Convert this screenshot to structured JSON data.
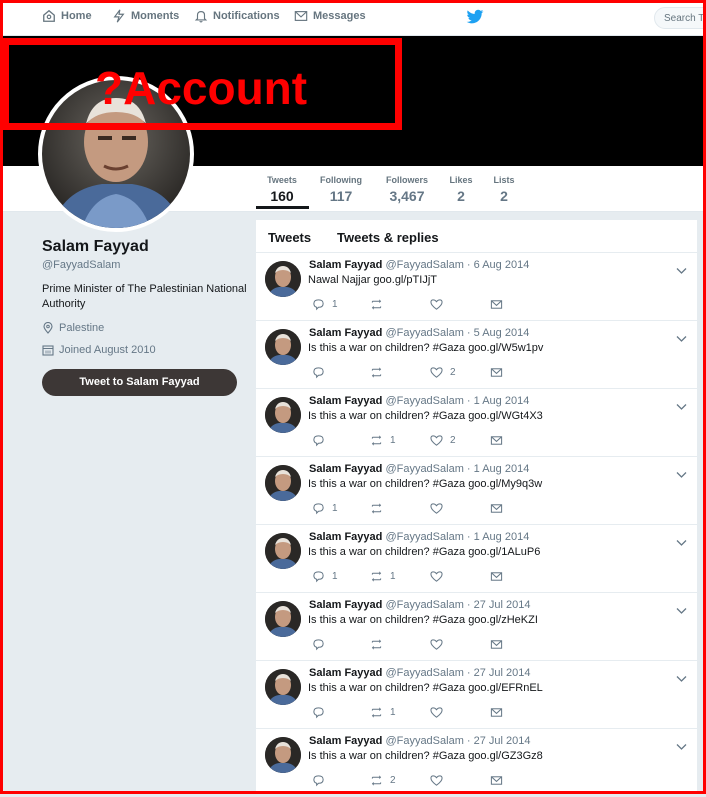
{
  "nav": {
    "home": "Home",
    "moments": "Moments",
    "notifications": "Notifications",
    "messages": "Messages",
    "search_placeholder": "Search Twitter"
  },
  "stamp": {
    "text": "?Account"
  },
  "stats": [
    {
      "label": "Tweets",
      "value": "160"
    },
    {
      "label": "Following",
      "value": "117"
    },
    {
      "label": "Followers",
      "value": "3,467"
    },
    {
      "label": "Likes",
      "value": "2"
    },
    {
      "label": "Lists",
      "value": "2"
    }
  ],
  "profile": {
    "name": "Salam Fayyad",
    "handle": "@FayyadSalam",
    "bio": "Prime Minister of The Palestinian National Authority",
    "location": "Palestine",
    "joined": "Joined August 2010",
    "tweet_to": "Tweet to Salam Fayyad"
  },
  "tabs": [
    "Tweets",
    "Tweets & replies"
  ],
  "tweets": [
    {
      "name": "Salam Fayyad",
      "handle": "@FayyadSalam",
      "date": "6 Aug 2014",
      "text": "Nawal Najjar goo.gl/pTIJjT",
      "replies": "1",
      "retweets": "",
      "likes": ""
    },
    {
      "name": "Salam Fayyad",
      "handle": "@FayyadSalam",
      "date": "5 Aug 2014",
      "text": "Is this a war on children? #Gaza goo.gl/W5w1pv",
      "replies": "",
      "retweets": "",
      "likes": "2"
    },
    {
      "name": "Salam Fayyad",
      "handle": "@FayyadSalam",
      "date": "1 Aug 2014",
      "text": "Is this a war on children? #Gaza goo.gl/WGt4X3",
      "replies": "",
      "retweets": "1",
      "likes": "2"
    },
    {
      "name": "Salam Fayyad",
      "handle": "@FayyadSalam",
      "date": "1 Aug 2014",
      "text": "Is this a war on children? #Gaza goo.gl/My9q3w",
      "replies": "1",
      "retweets": "",
      "likes": ""
    },
    {
      "name": "Salam Fayyad",
      "handle": "@FayyadSalam",
      "date": "1 Aug 2014",
      "text": "Is this a war on children? #Gaza goo.gl/1ALuP6",
      "replies": "1",
      "retweets": "1",
      "likes": ""
    },
    {
      "name": "Salam Fayyad",
      "handle": "@FayyadSalam",
      "date": "27 Jul 2014",
      "text": "Is this a war on children? #Gaza goo.gl/zHeKZI",
      "replies": "",
      "retweets": "",
      "likes": ""
    },
    {
      "name": "Salam Fayyad",
      "handle": "@FayyadSalam",
      "date": "27 Jul 2014",
      "text": "Is this a war on children? #Gaza goo.gl/EFRnEL",
      "replies": "",
      "retweets": "1",
      "likes": ""
    },
    {
      "name": "Salam Fayyad",
      "handle": "@FayyadSalam",
      "date": "27 Jul 2014",
      "text": "Is this a war on children? #Gaza goo.gl/GZ3Gz8",
      "replies": "",
      "retweets": "2",
      "likes": ""
    }
  ],
  "colors": {
    "stamp": "#ff0000",
    "twitter_blue": "#1da1f2",
    "banner": "#000000",
    "tweet_button": "#3d3736"
  }
}
